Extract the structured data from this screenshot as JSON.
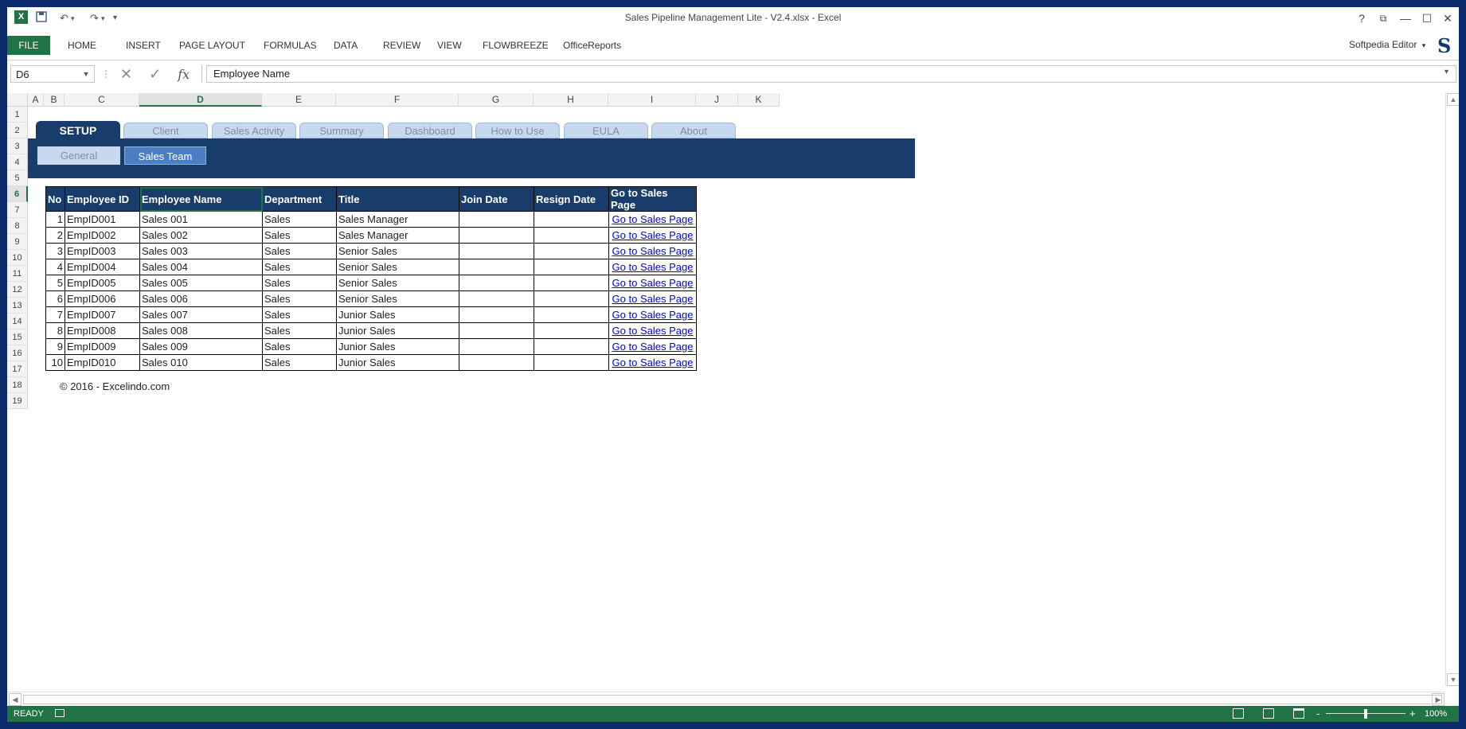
{
  "window": {
    "title": "Sales Pipeline Management Lite - V2.4.xlsx - Excel",
    "app_icon": "excel-icon",
    "controls": [
      "?",
      "⧉",
      "—",
      "☐",
      "✕"
    ]
  },
  "quick_access": {
    "save_icon": "save-icon",
    "undo_icon": "undo-icon",
    "redo_icon": "redo-icon",
    "customize": "▾"
  },
  "ribbon": {
    "tabs": [
      "FILE",
      "HOME",
      "INSERT",
      "PAGE LAYOUT",
      "FORMULAS",
      "DATA",
      "REVIEW",
      "VIEW",
      "FLOWBREEZE",
      "OfficeReports"
    ],
    "user": "Softpedia Editor",
    "user_caret": "▾"
  },
  "formula_bar": {
    "name_box": "D6",
    "cancel": "✕",
    "enter": "✓",
    "fx": "fx",
    "content": "Employee Name"
  },
  "columns": [
    "A",
    "B",
    "C",
    "D",
    "E",
    "F",
    "G",
    "H",
    "I",
    "J",
    "K"
  ],
  "rows": [
    "1",
    "2",
    "3",
    "4",
    "5",
    "6",
    "7",
    "8",
    "9",
    "10",
    "11",
    "12",
    "13",
    "14",
    "15",
    "16",
    "17",
    "18",
    "19"
  ],
  "selected_cell": {
    "column": "D",
    "row": "6"
  },
  "nav_tabs": [
    "SETUP",
    "Client",
    "Sales Activity",
    "Summary",
    "Dashboard",
    "How to Use",
    "EULA",
    "About"
  ],
  "sub_tabs": [
    "General",
    "Sales Team"
  ],
  "table": {
    "headers": [
      "No",
      "Employee ID",
      "Employee Name",
      "Department",
      "Title",
      "Join Date",
      "Resign Date",
      "Go to Sales Page"
    ],
    "rows": [
      [
        "1",
        "EmpID001",
        "Sales 001",
        "Sales",
        "Sales Manager",
        "",
        "",
        "Go to Sales Page"
      ],
      [
        "2",
        "EmpID002",
        "Sales 002",
        "Sales",
        "Sales Manager",
        "",
        "",
        "Go to Sales Page"
      ],
      [
        "3",
        "EmpID003",
        "Sales 003",
        "Sales",
        "Senior Sales",
        "",
        "",
        "Go to Sales Page"
      ],
      [
        "4",
        "EmpID004",
        "Sales 004",
        "Sales",
        "Senior Sales",
        "",
        "",
        "Go to Sales Page"
      ],
      [
        "5",
        "EmpID005",
        "Sales 005",
        "Sales",
        "Senior Sales",
        "",
        "",
        "Go to Sales Page"
      ],
      [
        "6",
        "EmpID006",
        "Sales 006",
        "Sales",
        "Senior Sales",
        "",
        "",
        "Go to Sales Page"
      ],
      [
        "7",
        "EmpID007",
        "Sales 007",
        "Sales",
        "Junior Sales",
        "",
        "",
        "Go to Sales Page"
      ],
      [
        "8",
        "EmpID008",
        "Sales 008",
        "Sales",
        "Junior Sales",
        "",
        "",
        "Go to Sales Page"
      ],
      [
        "9",
        "EmpID009",
        "Sales 009",
        "Sales",
        "Junior Sales",
        "",
        "",
        "Go to Sales Page"
      ],
      [
        "10",
        "EmpID010",
        "Sales 010",
        "Sales",
        "Junior Sales",
        "",
        "",
        "Go to Sales Page"
      ]
    ]
  },
  "footer_note": "© 2016 - Excelindo.com",
  "status_bar": {
    "mode": "READY",
    "zoom": "100%",
    "zoom_minus": "-",
    "zoom_plus": "+",
    "zoom_level": 0.5
  },
  "colors": {
    "excel_green": "#217346",
    "navy": "#183d6b",
    "tab_light": "#c7d9ef",
    "sub_active": "#4a7fc5",
    "link": "#0000ee"
  }
}
